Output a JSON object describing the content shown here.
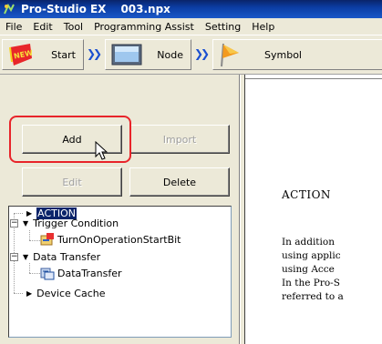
{
  "window": {
    "app_title": "Pro-Studio EX",
    "file_name": "003.npx"
  },
  "menu": [
    "File",
    "Edit",
    "Tool",
    "Programming Assist",
    "Setting",
    "Help"
  ],
  "toolbar": {
    "start_label": "Start",
    "node_label": "Node",
    "symbol_label": "Symbol",
    "new_badge": "NEW"
  },
  "buttons": {
    "add": "Add",
    "import": "Import",
    "edit": "Edit",
    "delete": "Delete"
  },
  "tree": {
    "action": "ACTION",
    "trigger_condition": "Trigger Condition",
    "turn_on": "TurnOnOperationStartBit",
    "data_transfer": "Data Transfer",
    "data_transfer_child": "DataTransfer",
    "device_cache": "Device Cache"
  },
  "document": {
    "heading": "ACTION",
    "lines": [
      "In addition",
      "using applic",
      "using Acce",
      "In the Pro-S",
      "referred to a"
    ]
  },
  "colors": {
    "title_bar": "#0a246a",
    "highlight": "#e8242a",
    "selection": "#0a246a"
  }
}
